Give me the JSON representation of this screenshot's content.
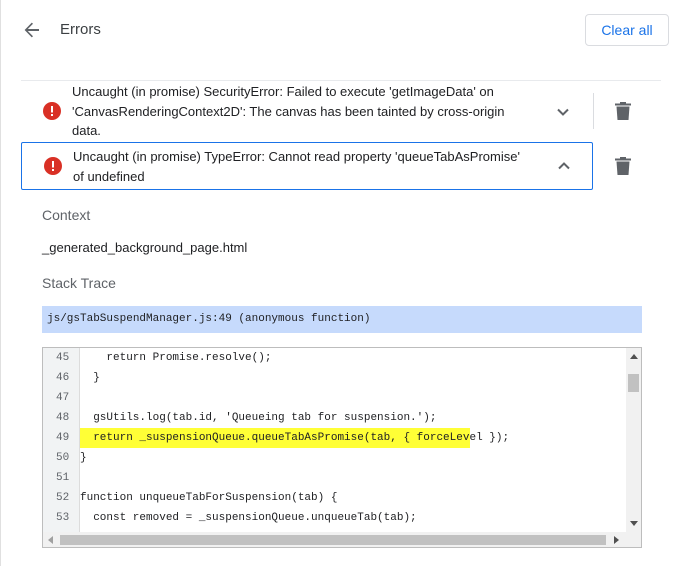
{
  "header": {
    "title": "Errors",
    "clear_all_label": "Clear all"
  },
  "errors": [
    {
      "message": "Uncaught (in promise) SecurityError: Failed to execute 'getImageData' on 'CanvasRenderingContext2D': The canvas has been tainted by cross-origin data.",
      "expanded": false
    },
    {
      "message": "Uncaught (in promise) TypeError: Cannot read property 'queueTabAsPromise' of undefined",
      "expanded": true
    }
  ],
  "details": {
    "context_label": "Context",
    "context_value": "_generated_background_page.html",
    "stack_trace_label": "Stack Trace",
    "stack_frame": "js/gsTabSuspendManager.js:49 (anonymous function)"
  },
  "code": {
    "highlight_line": "49",
    "lines": [
      {
        "num": "45",
        "text": "    return Promise.resolve();"
      },
      {
        "num": "46",
        "text": "  }"
      },
      {
        "num": "47",
        "text": ""
      },
      {
        "num": "48",
        "text": "  gsUtils.log(tab.id, 'Queueing tab for suspension.');"
      },
      {
        "num": "49",
        "text": "  return _suspensionQueue.queueTabAsPromise(tab, { forceLevel });"
      },
      {
        "num": "50",
        "text": "}"
      },
      {
        "num": "51",
        "text": ""
      },
      {
        "num": "52",
        "text": "function unqueueTabForSuspension(tab) {"
      },
      {
        "num": "53",
        "text": "  const removed = _suspensionQueue.unqueueTab(tab);"
      }
    ]
  },
  "colors": {
    "accent": "#1a73e8",
    "error_icon": "#d93025",
    "highlight": "#ffff36",
    "stack_frame_bg": "#c6dafc"
  },
  "icons": {
    "back": "arrow-back-icon",
    "error": "error-icon",
    "expand": "chevron-down-icon",
    "collapse": "chevron-up-icon",
    "delete": "trash-icon"
  }
}
